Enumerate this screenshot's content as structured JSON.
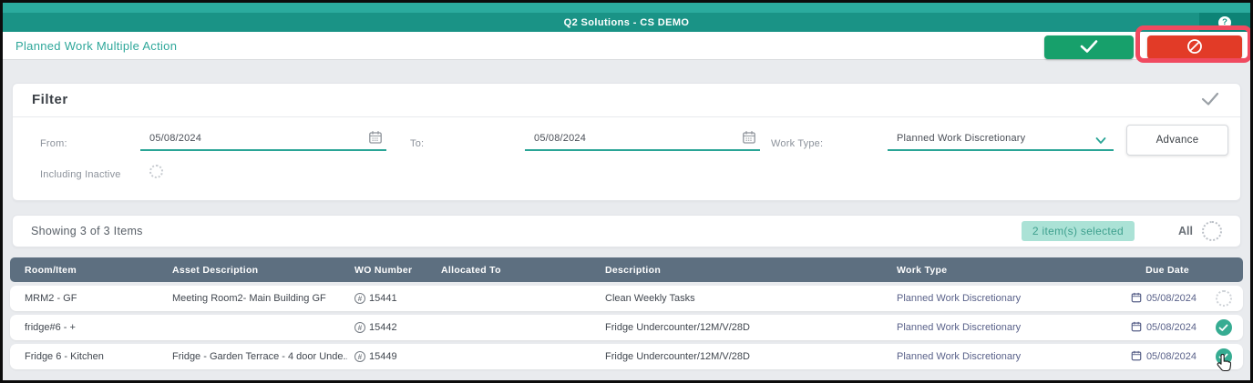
{
  "titlebar": {
    "title": "Q2 Solutions - CS DEMO",
    "help_icon": "?"
  },
  "header": {
    "page_title": "Planned Work Multiple Action"
  },
  "filter": {
    "title": "Filter",
    "from_label": "From:",
    "from_value": "05/08/2024",
    "to_label": "To:",
    "to_value": "05/08/2024",
    "work_type_label": "Work Type:",
    "work_type_value": "Planned Work Discretionary",
    "advance_label": "Advance",
    "including_inactive_label": "Including Inactive"
  },
  "list": {
    "showing_text": "Showing 3 of 3 Items",
    "selected_badge": "2 item(s) selected",
    "all_label": "All"
  },
  "table": {
    "wo_prefix": "#",
    "columns": [
      "Room/Item",
      "Asset Description",
      "WO Number",
      "Allocated To",
      "Description",
      "Work Type",
      "Due Date"
    ],
    "rows": [
      {
        "room_item": "MRM2 - GF",
        "asset_description": "Meeting Room2- Main Building GF",
        "wo_number": "15441",
        "allocated_to": "",
        "description": "Clean Weekly Tasks",
        "work_type": "Planned Work Discretionary",
        "due_date": "05/08/2024",
        "selected": false
      },
      {
        "room_item": "fridge#6 - +",
        "asset_description": "",
        "wo_number": "15442",
        "allocated_to": "",
        "description": "Fridge Undercounter/12M/V/28D",
        "work_type": "Planned Work Discretionary",
        "due_date": "05/08/2024",
        "selected": true
      },
      {
        "room_item": "Fridge 6 - Kitchen",
        "asset_description": "Fridge - Garden Terrace - 4 door Unde...",
        "wo_number": "15449",
        "allocated_to": "",
        "description": "Fridge Undercounter/12M/V/28D",
        "work_type": "Planned Work Discretionary",
        "due_date": "05/08/2024",
        "selected": true
      }
    ]
  },
  "colors": {
    "topstrip": "#2bab9e",
    "titleband": "#1a9386",
    "accent_teal": "#2aa596",
    "approve_green": "#17a06b",
    "reject_red": "#e23b27",
    "annotation_pink": "#f04a60",
    "table_header": "#5d6f80",
    "badge_bg": "#abe2d6",
    "badge_text": "#3fa08e",
    "checked_circle": "#36ac92"
  }
}
